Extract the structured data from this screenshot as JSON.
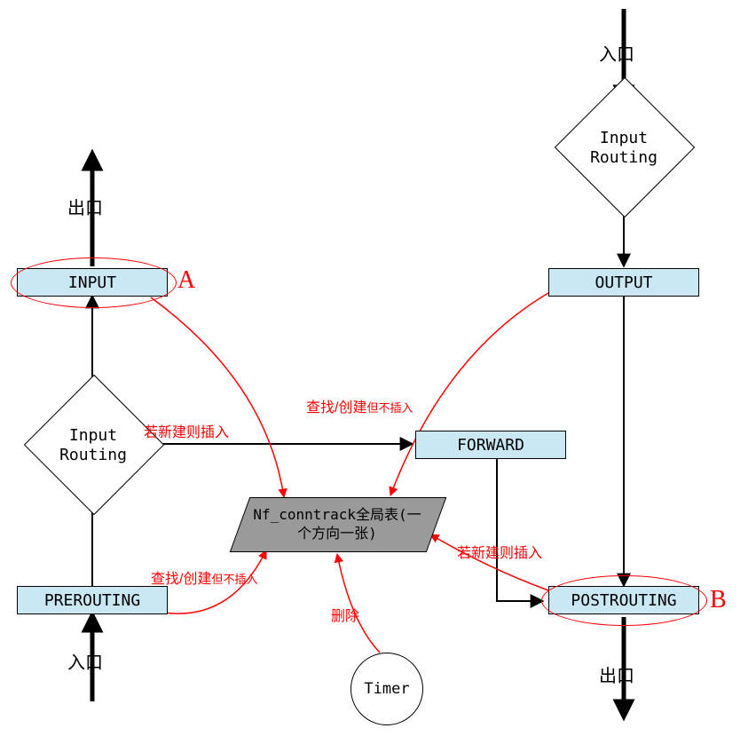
{
  "nodes": {
    "input_box": "INPUT",
    "output_box": "OUTPUT",
    "forward_box": "FORWARD",
    "prerouting_box": "PREROUTING",
    "postrouting_box": "POSTROUTING",
    "input_routing": "Input\nRouting",
    "input_routing2": "Input\nRouting",
    "conntrack": "Nf_conntrack全局表(一个方向一张)",
    "timer": "Timer"
  },
  "labels": {
    "in": "入口",
    "out": "出口"
  },
  "annotations": {
    "lookup_create": "查找/创建",
    "no_insert": "但不插入",
    "new_insert": "若新建则插入",
    "delete": "删除",
    "A": "A",
    "B": "B"
  }
}
